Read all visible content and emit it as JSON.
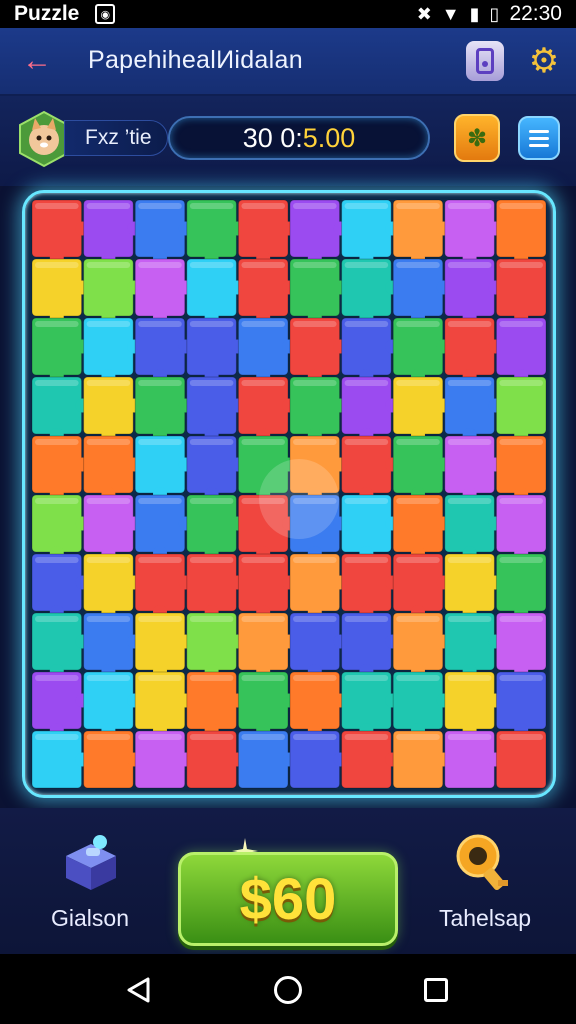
{
  "status_bar": {
    "app_name": "Puzzle",
    "time": "22:30"
  },
  "app_bar": {
    "title": "PapehihealИidalan"
  },
  "hud": {
    "player_name": "Fxz ’tie",
    "timer_primary": "30 0:",
    "timer_secondary": "5.00"
  },
  "bottom": {
    "left_label": "Gialson",
    "price_label": "$60",
    "right_label": "Tahelsap"
  },
  "colors": {
    "accent_glow": "#68e7ff",
    "price_text": "#ffe23a",
    "timer_highlight": "#ffd23a"
  },
  "icons": {
    "back": "arrow-left-icon",
    "appbar_right": "gear-icon",
    "hint": "lightbulb-icon",
    "menu": "menu-icon",
    "gallery": "treasure-box-icon",
    "tool": "key-icon"
  }
}
